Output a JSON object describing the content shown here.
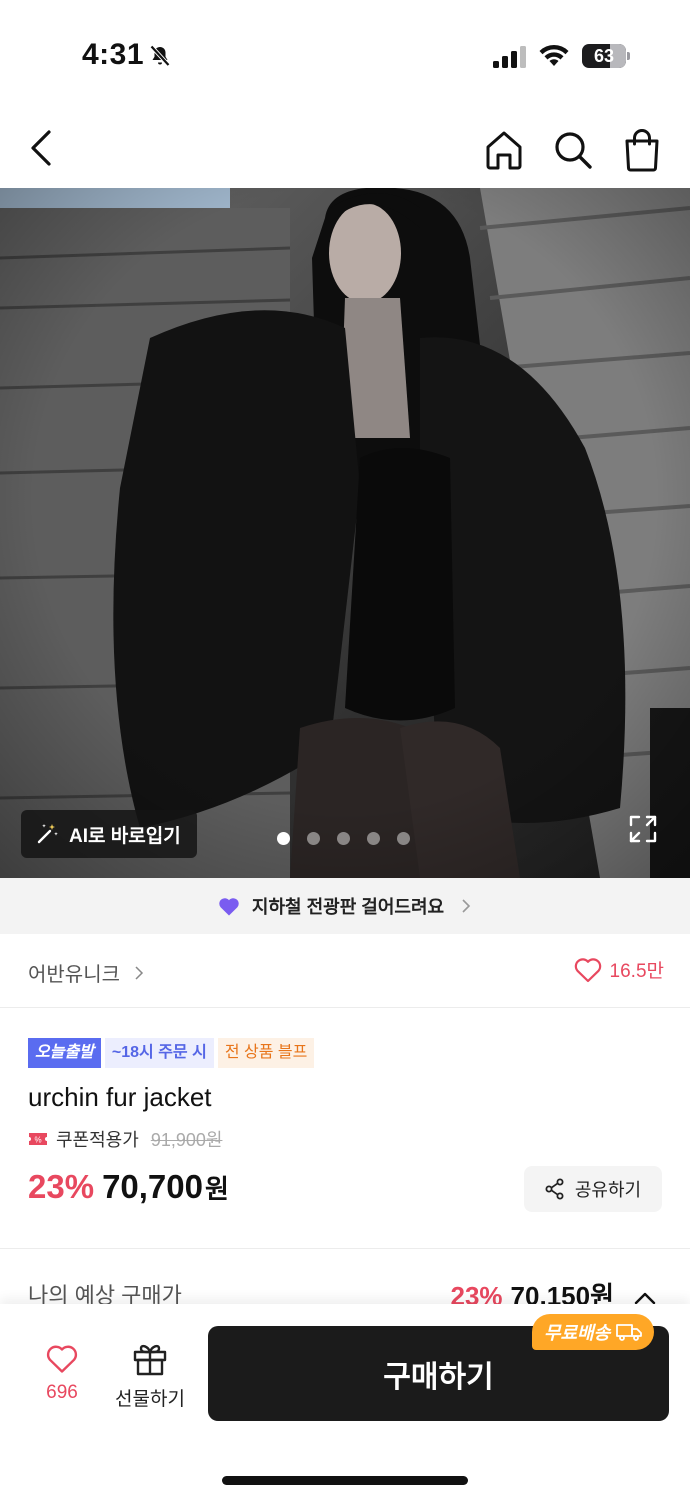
{
  "status_bar": {
    "time": "4:31",
    "battery": "63",
    "icons": [
      "bell-off-icon",
      "signal-icon",
      "wifi-icon",
      "battery-icon"
    ]
  },
  "nav": {
    "icons": [
      "back-icon",
      "home-icon",
      "search-icon",
      "shopping-bag-icon"
    ]
  },
  "hero": {
    "ai_try_label": "AI로 바로입기",
    "image_count": 5,
    "active_index": 0
  },
  "banner": {
    "text": "지하철 전광판 걸어드려요",
    "heart_color": "#7a5cf0"
  },
  "brand": {
    "name": "어반유니크",
    "likes": "16.5만"
  },
  "product": {
    "badges": {
      "today": "오늘출발",
      "time": "~18시 주문 시",
      "sale": "전 상품 블프"
    },
    "title": "urchin fur jacket",
    "coupon_label": "쿠폰적용가",
    "original_price": "91,900원",
    "discount": "23%",
    "price": "70,700",
    "currency": "원",
    "share_label": "공유하기"
  },
  "expected_price": {
    "label": "나의 예상 구매가",
    "discount": "23%",
    "price": "70,150원"
  },
  "bottom_bar": {
    "wish_count": "696",
    "gift_label": "선물하기",
    "buy_label": "구매하기",
    "free_shipping": "무료배송"
  },
  "colors": {
    "accent_red": "#e8485f",
    "badge_blue": "#5a6cf0",
    "buy_button": "#1b1b1b",
    "free_ship": "#ffa726"
  }
}
